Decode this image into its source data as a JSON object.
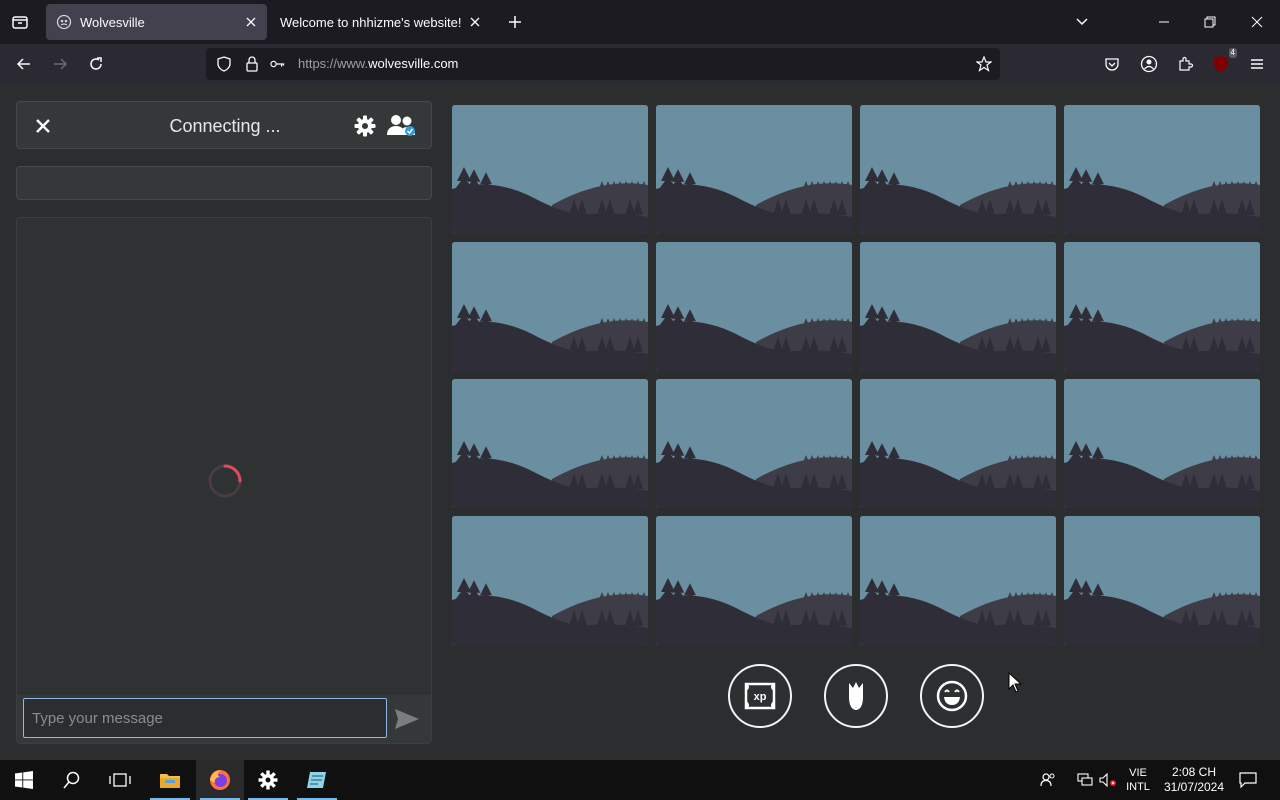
{
  "browser": {
    "tabs": [
      {
        "title": "Wolvesville",
        "active": true
      },
      {
        "title": "Welcome to nhhizme's website!",
        "active": false
      }
    ],
    "url_prefix": "https://www.",
    "url_domain": "wolvesville.com",
    "extension_badge": "4"
  },
  "game": {
    "status": "Connecting ...",
    "chat_placeholder": "Type your message",
    "player_slots": 16,
    "action_buttons": [
      {
        "name": "xp-scroll-icon",
        "label": "xp"
      },
      {
        "name": "rose-icon",
        "label": ""
      },
      {
        "name": "emoji-icon",
        "label": ""
      }
    ]
  },
  "taskbar": {
    "lang_line1": "VIE",
    "lang_line2": "INTL",
    "time": "2:08 CH",
    "date": "31/07/2024"
  },
  "colors": {
    "sky": "#6a8fa0",
    "hill_dark": "#2f2e38",
    "hill_mid": "#3e3d47",
    "accent": "#8fb6e8",
    "spinner": "#e04a5a"
  }
}
